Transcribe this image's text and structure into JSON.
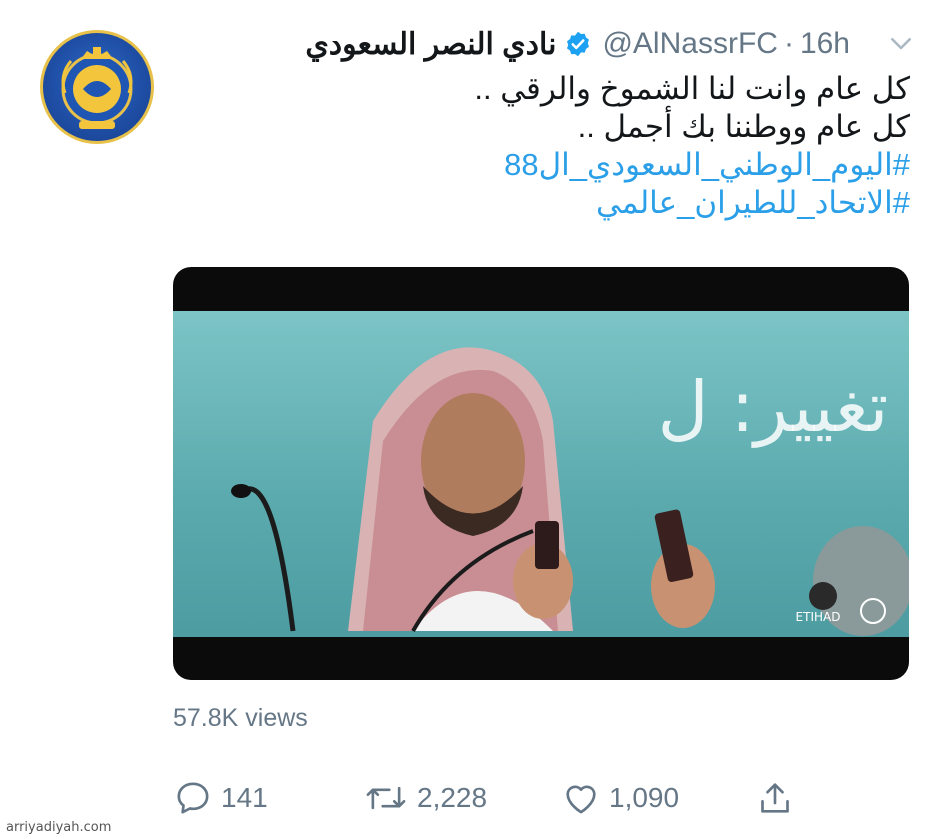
{
  "tweet": {
    "display_name": "نادي النصر السعودي",
    "handle": "@AlNassrFC",
    "separator": "·",
    "time": "16h",
    "text_lines": [
      "كل عام وانت لنا الشموخ والرقي  ..",
      "كل عام ووطننا بك أجمل .."
    ],
    "hashtags": [
      "#اليوم_الوطني_السعودي_ال88",
      "#الاتحاد_للطيران_عالمي"
    ],
    "views": "57.8K views",
    "actions": {
      "replies": "141",
      "retweets": "2,228",
      "likes": "1,090"
    }
  },
  "video": {
    "overlay_text": "تغيير: ل",
    "sponsor_text": "ETIHAD"
  },
  "watermark": "arriyadiyah.com",
  "colors": {
    "text": "#14171a",
    "muted": "#657786",
    "link": "#2b9fe8",
    "verified": "#1da1f2"
  },
  "icons": {
    "verified": "verified-badge-icon",
    "menu": "chevron-down-icon",
    "reply": "reply-bubble-icon",
    "retweet": "retweet-icon",
    "like": "heart-icon",
    "share": "share-upload-icon"
  }
}
